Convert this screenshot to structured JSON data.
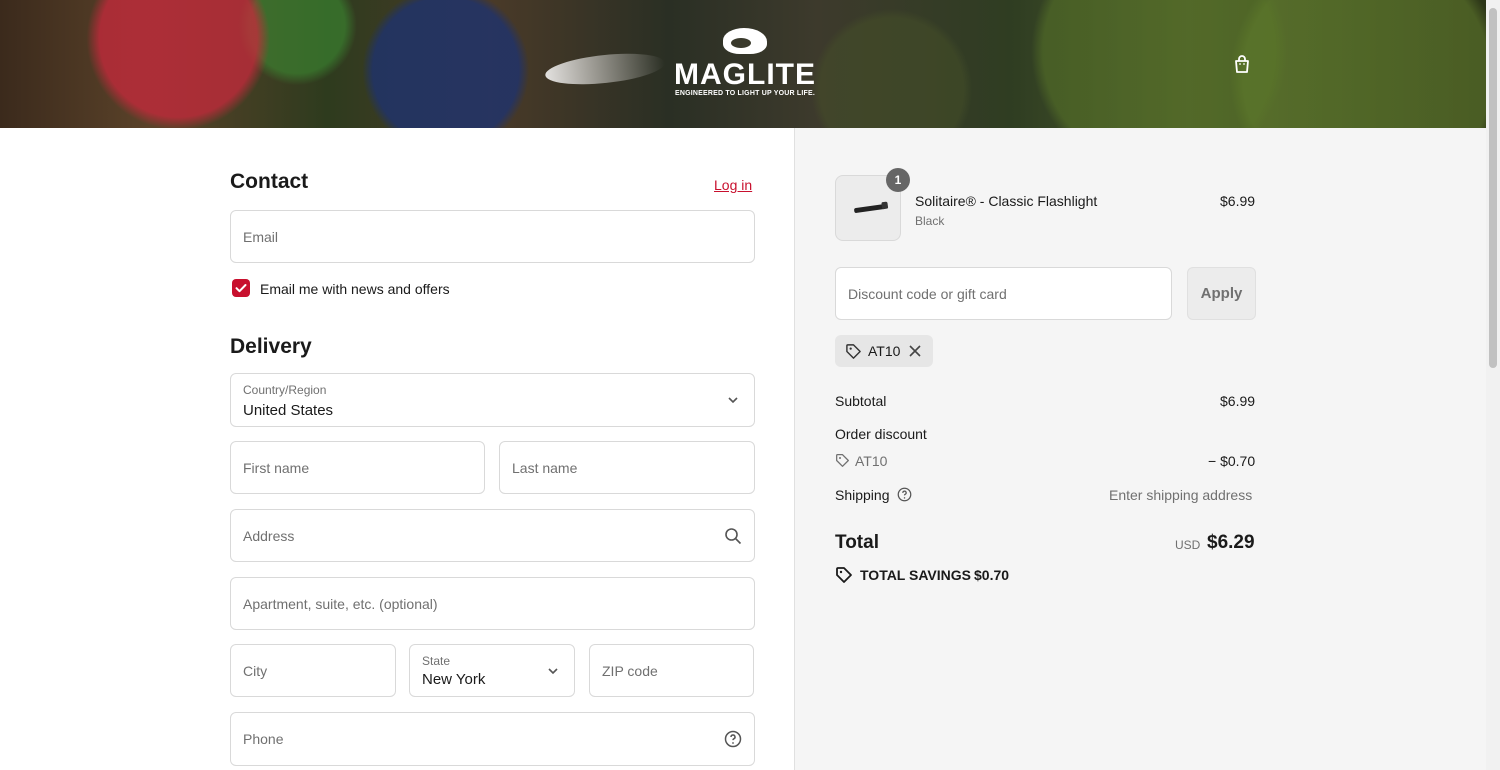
{
  "header": {
    "brand": "MAGLITE",
    "tagline": "ENGINEERED TO LIGHT UP YOUR LIFE.",
    "cart_icon": "shopping-bag-icon"
  },
  "contact": {
    "title": "Contact",
    "login_link": "Log in",
    "email_placeholder": "Email",
    "newsletter_label": "Email me with news and offers",
    "newsletter_checked": true
  },
  "delivery": {
    "title": "Delivery",
    "country_label": "Country/Region",
    "country_value": "United States",
    "first_name_placeholder": "First name",
    "last_name_placeholder": "Last name",
    "address_placeholder": "Address",
    "apartment_placeholder": "Apartment, suite, etc. (optional)",
    "city_placeholder": "City",
    "state_label": "State",
    "state_value": "New York",
    "zip_placeholder": "ZIP code",
    "phone_placeholder": "Phone"
  },
  "summary": {
    "item": {
      "quantity": "1",
      "name": "Solitaire® - Classic Flashlight",
      "variant": "Black",
      "price": "$6.99"
    },
    "discount_placeholder": "Discount code or gift card",
    "apply_label": "Apply",
    "applied_code": "AT10",
    "subtotal_label": "Subtotal",
    "subtotal_value": "$6.99",
    "order_discount_label": "Order discount",
    "discount_code": "AT10",
    "discount_value": "− $0.70",
    "shipping_label": "Shipping",
    "shipping_value": "Enter shipping address",
    "total_label": "Total",
    "currency": "USD",
    "total_value": "$6.29",
    "savings_label": "TOTAL SAVINGS",
    "savings_value": "$0.70"
  },
  "colors": {
    "accent": "#c8102e",
    "panel": "#f5f5f5"
  }
}
